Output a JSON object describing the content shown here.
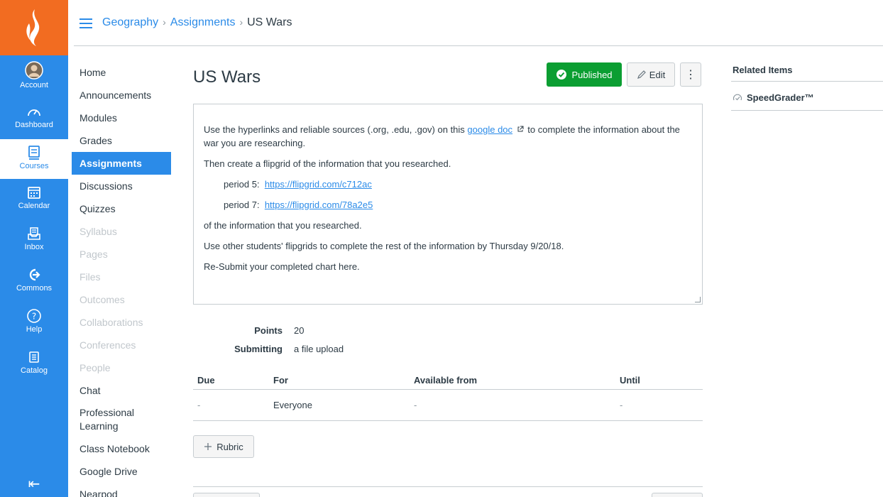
{
  "nav": {
    "items": [
      {
        "label": "Account",
        "icon": "account-avatar"
      },
      {
        "label": "Dashboard",
        "icon": "dashboard-icon"
      },
      {
        "label": "Courses",
        "icon": "courses-icon"
      },
      {
        "label": "Calendar",
        "icon": "calendar-icon"
      },
      {
        "label": "Inbox",
        "icon": "inbox-icon"
      },
      {
        "label": "Commons",
        "icon": "commons-icon"
      },
      {
        "label": "Help",
        "icon": "help-icon"
      },
      {
        "label": "Catalog",
        "icon": "catalog-icon"
      }
    ],
    "collapse_glyph": "⇤"
  },
  "breadcrumb": {
    "course": "Geography",
    "section": "Assignments",
    "current": "US Wars",
    "separator": "›"
  },
  "course_nav": {
    "home": "Home",
    "announcements": "Announcements",
    "modules": "Modules",
    "grades": "Grades",
    "assignments": "Assignments",
    "discussions": "Discussions",
    "quizzes": "Quizzes",
    "syllabus": "Syllabus",
    "pages": "Pages",
    "files": "Files",
    "outcomes": "Outcomes",
    "collaborations": "Collaborations",
    "conferences": "Conferences",
    "people": "People",
    "chat": "Chat",
    "professional_learning_1": "Professional",
    "professional_learning_2": "Learning",
    "class_notebook": "Class Notebook",
    "google_drive": "Google Drive",
    "nearpod": "Nearpod"
  },
  "assignment": {
    "title": "US Wars",
    "published_label": "Published",
    "edit_label": "Edit",
    "more_glyph": "⋮",
    "desc": {
      "p1_before": "Use the hyperlinks and reliable sources (.org, .edu, .gov) on this ",
      "p1_link": "google doc",
      "p1_after": " to complete the information about the war you are researching.",
      "p2": "Then create a flipgrid of the information that you researched.",
      "p3_label": "period 5:",
      "p3_link": "https://flipgrid.com/c712ac",
      "p4_label": "period 7:",
      "p4_link": "https://flipgrid.com/78a2e5",
      "p5": "of the information that you researched.",
      "p6": "Use other students' flipgrids to complete the rest of the information by Thursday  9/20/18.",
      "p7": "Re-Submit your completed chart here."
    },
    "points_label": "Points",
    "points_value": "20",
    "submitting_label": "Submitting",
    "submitting_value": "a file upload",
    "table": {
      "headers": {
        "due": "Due",
        "for": "For",
        "available": "Available from",
        "until": "Until"
      },
      "row": {
        "due": "-",
        "for": "Everyone",
        "available": "-",
        "until": "-"
      }
    },
    "rubric_label": "Rubric"
  },
  "related": {
    "heading": "Related Items",
    "speedgrader": "SpeedGrader™"
  },
  "colors": {
    "nav_blue": "#2b8be8",
    "brand_orange": "#f26c21",
    "published_green": "#0b9e32"
  }
}
